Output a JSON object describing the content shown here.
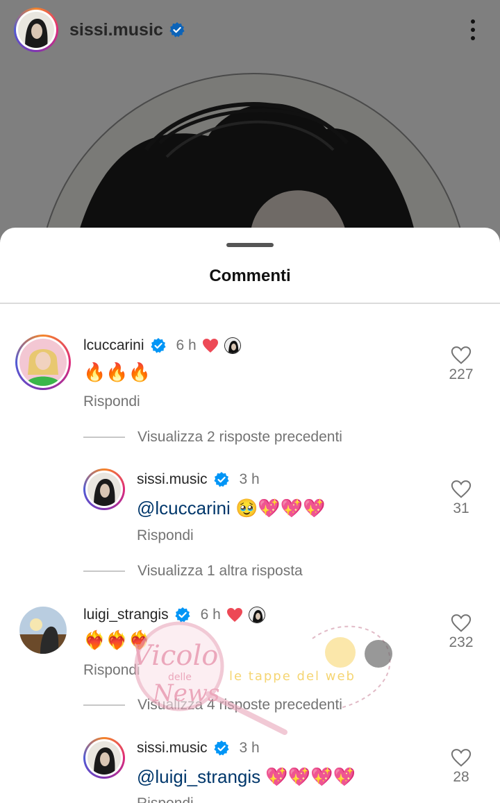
{
  "post": {
    "username": "sissi.music"
  },
  "sheet": {
    "title": "Commenti"
  },
  "comments": [
    {
      "username": "lcuccarini",
      "time": "6 h",
      "text": "🔥🔥🔥",
      "reply_label": "Rispondi",
      "likes": "227",
      "view_replies": "Visualizza 2 risposte precedenti"
    },
    {
      "username": "sissi.music",
      "time": "3 h",
      "mention": "@lcuccarini",
      "text": "🥹💖💖💖",
      "reply_label": "Rispondi",
      "likes": "31",
      "view_replies": "Visualizza 1 altra risposta"
    },
    {
      "username": "luigi_strangis",
      "time": "6 h",
      "text": "❤️‍🔥❤️‍🔥❤️‍🔥",
      "reply_label": "Rispondi",
      "likes": "232",
      "view_replies": "Visualizza 4 risposte precedenti"
    },
    {
      "username": "sissi.music",
      "time": "3 h",
      "mention": "@luigi_strangis",
      "text": "💖💖💖💖",
      "reply_label": "Rispondi",
      "likes": "28"
    }
  ],
  "watermark": {
    "line1": "Vicolo",
    "line2": "delle",
    "line3": "News",
    "line4": "le tappe del web"
  },
  "colors": {
    "verified": "#0095f6",
    "heart_red": "#ed4956",
    "mention": "#00376b",
    "secondary_text": "#737373"
  },
  "icons": {
    "verified": "verified-badge-icon",
    "like": "heart-outline-icon",
    "creator_like": "heart-filled-icon",
    "more": "more-vertical-icon"
  }
}
